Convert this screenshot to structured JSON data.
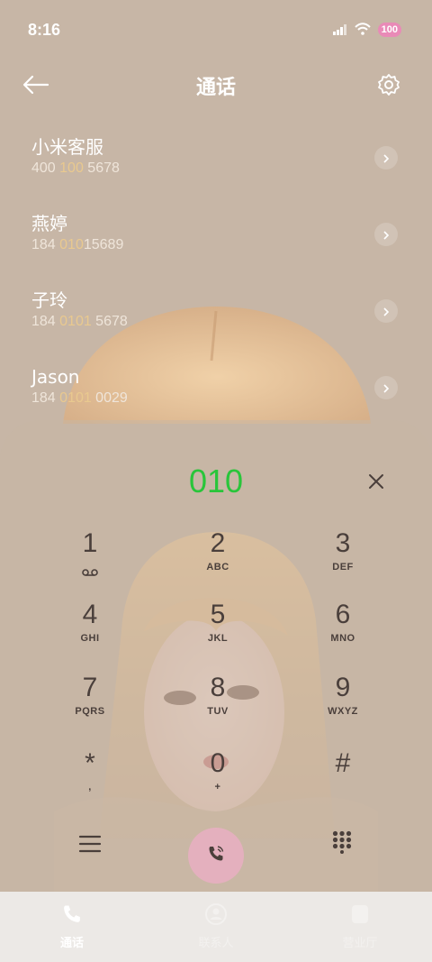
{
  "status_bar": {
    "time": "8:16",
    "battery": "100",
    "icons": [
      "signal-icon",
      "wifi-icon",
      "battery-icon"
    ]
  },
  "app_bar": {
    "title": "通话",
    "back_icon": "back-arrow-icon",
    "settings_icon": "gear-icon"
  },
  "contacts": [
    {
      "name": "小米客服",
      "number_pre": "400 ",
      "number_hl": "100",
      "number_post": " 5678"
    },
    {
      "name": "燕婷",
      "number_pre": "184 ",
      "number_hl": "010",
      "number_post": "15689"
    },
    {
      "name": "子玲",
      "number_pre": "184 ",
      "number_hl": "0101",
      "number_post": " 5678"
    },
    {
      "name": "Jason",
      "number_pre": "184 ",
      "number_hl": "0101",
      "number_post": " 0029"
    }
  ],
  "dialer": {
    "input_value": "010",
    "keys": [
      {
        "digit": "1",
        "letters": "voicemail-icon"
      },
      {
        "digit": "2",
        "letters": "ABC"
      },
      {
        "digit": "3",
        "letters": "DEF"
      },
      {
        "digit": "4",
        "letters": "GHI"
      },
      {
        "digit": "5",
        "letters": "JKL"
      },
      {
        "digit": "6",
        "letters": "MNO"
      },
      {
        "digit": "7",
        "letters": "PQRS"
      },
      {
        "digit": "8",
        "letters": "TUV"
      },
      {
        "digit": "9",
        "letters": "WXYZ"
      },
      {
        "digit": "*",
        "letters": ","
      },
      {
        "digit": "0",
        "letters": "+"
      },
      {
        "digit": "#",
        "letters": ""
      }
    ],
    "accent_color": "#29c53a",
    "call_button_color": "#e4b0be"
  },
  "bottom_nav": {
    "tabs": [
      {
        "label": "通话",
        "icon": "phone-icon",
        "active": true
      },
      {
        "label": "联系人",
        "icon": "contacts-icon",
        "active": false
      },
      {
        "label": "营业厅",
        "icon": "store-icon",
        "active": false
      }
    ]
  }
}
